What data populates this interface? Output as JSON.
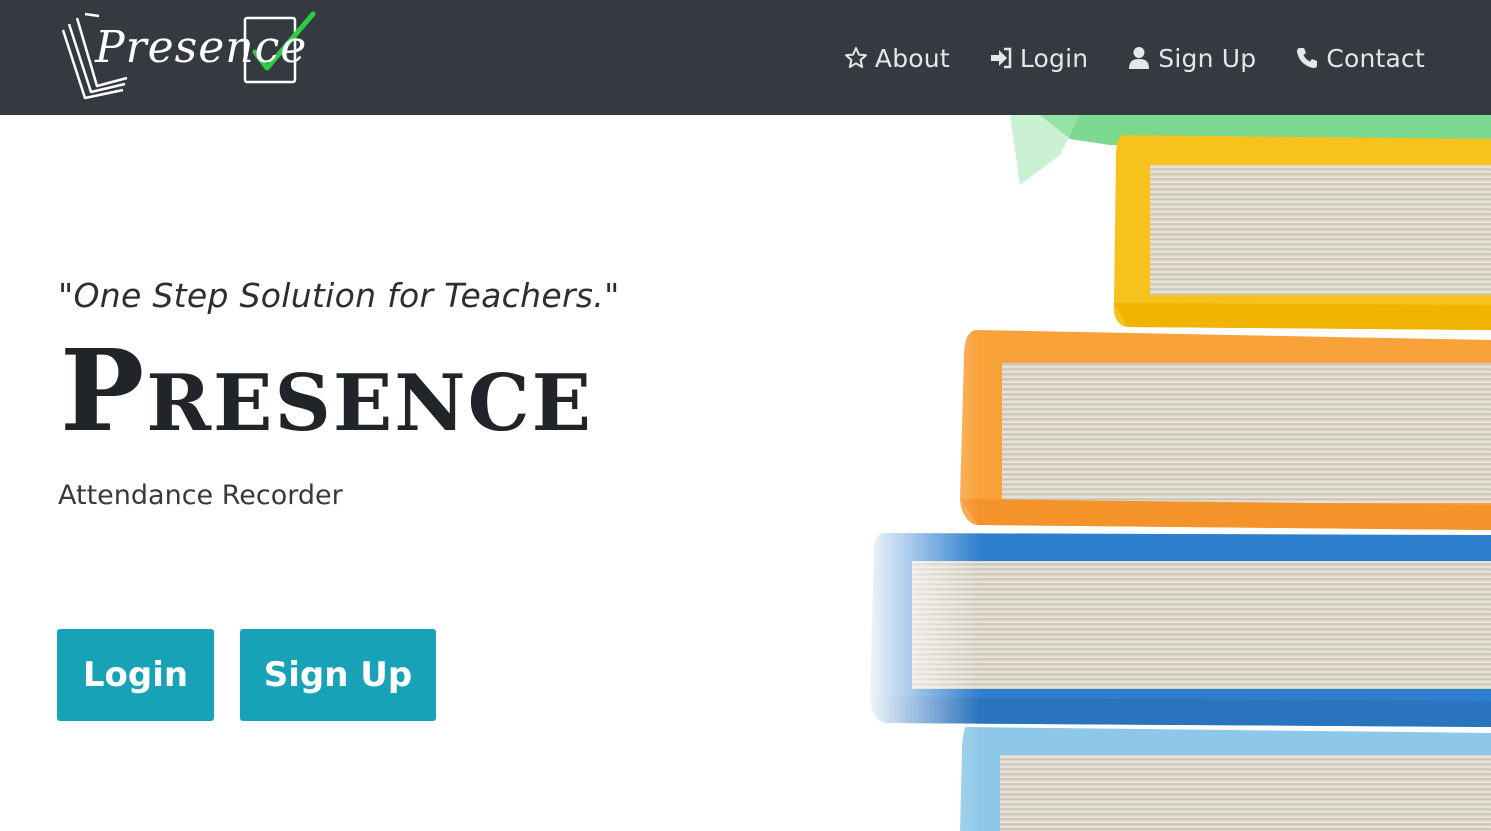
{
  "brand": {
    "logo_text": "Presence"
  },
  "nav": {
    "items": [
      {
        "label": "About",
        "icon": "star-icon"
      },
      {
        "label": "Login",
        "icon": "sign-in-icon"
      },
      {
        "label": "Sign Up",
        "icon": "user-icon"
      },
      {
        "label": "Contact",
        "icon": "phone-icon"
      }
    ]
  },
  "hero": {
    "tagline": "\"One Step Solution for Teachers.\"",
    "title": "Presence",
    "subtitle": "Attendance Recorder",
    "login_label": "Login",
    "signup_label": "Sign Up"
  },
  "colors": {
    "navbar": "#343a40",
    "accent": "#17a2b8",
    "check": "#2ecc40"
  }
}
